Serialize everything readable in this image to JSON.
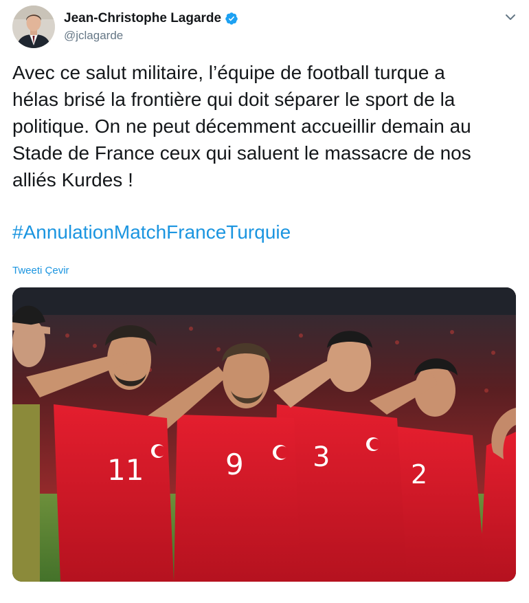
{
  "user": {
    "display_name": "Jean-Christophe Lagarde",
    "handle": "@jclagarde",
    "verified": true,
    "verified_color": "#1da1f2"
  },
  "tweet": {
    "lines": [
      "Avec ce salut militaire, l’équipe de football turque a",
      "hélas brisé la frontière qui doit séparer le sport de la",
      "politique. On ne peut décemment accueillir demain au",
      "Stade de France ceux qui saluent le massacre de nos",
      "alliés Kurdes !"
    ],
    "hashtag": "#AnnulationMatchFranceTurquie",
    "translate_label": "Tweeti Çevir"
  },
  "media": {
    "jersey_numbers": [
      "11",
      "9",
      "3",
      "2"
    ],
    "kit_color": "#d9192a"
  },
  "colors": {
    "link": "#1b95e0",
    "text": "#14171a",
    "secondary": "#657786"
  },
  "icons": {
    "verified": "verified-badge-icon",
    "menu": "chevron-down-icon"
  }
}
